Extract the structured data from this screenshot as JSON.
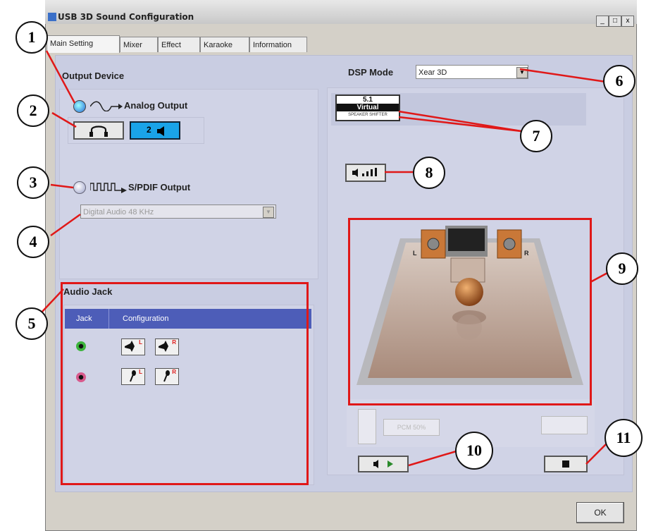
{
  "window": {
    "title": "USB 3D Sound Configuration",
    "controls": {
      "minimize": "_",
      "maximize": "□",
      "close": "x"
    }
  },
  "tabs": [
    {
      "label": "Main Setting"
    },
    {
      "label": "Mixer"
    },
    {
      "label": "Effect"
    },
    {
      "label": "Karaoke"
    },
    {
      "label": "Information"
    }
  ],
  "output_device": {
    "heading": "Output Device",
    "analog_label": "Analog Output",
    "spdif_label": "S/PDIF Output",
    "speaker_button_label": "2",
    "spdif_rate": "Digital Audio 48 KHz"
  },
  "dsp": {
    "label": "DSP Mode",
    "value": "Xear 3D",
    "badge_top": "5.1",
    "badge_mid": "Virtual",
    "badge_bottom": "SPEAKER SHIFTER"
  },
  "speaker_test": {
    "left_label": "L",
    "right_label": "R"
  },
  "bottom_panel": {
    "center_text": "PCM 50%"
  },
  "audio_jack": {
    "heading": "Audio Jack",
    "col_jack": "Jack",
    "col_config": "Configuration",
    "row1_left": "L",
    "row1_right": "R",
    "row2_left": "L",
    "row2_right": "R"
  },
  "buttons": {
    "ok": "OK"
  },
  "callouts": [
    "1",
    "2",
    "3",
    "4",
    "5",
    "6",
    "7",
    "8",
    "9",
    "10",
    "11"
  ],
  "colors": {
    "annotation_red": "#e01818",
    "panel_bg": "#c9cde2",
    "header_blue": "#4d5db8"
  }
}
